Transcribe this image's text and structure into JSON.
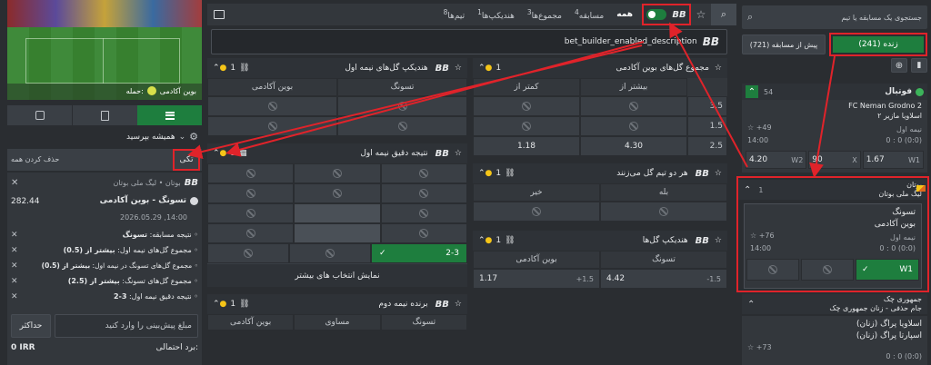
{
  "left": {
    "media": {
      "home_label": "حمله:",
      "team": "بوین آکادمی"
    },
    "tabs": [
      "betslip",
      "my-bets",
      "history"
    ],
    "settings_label": "همیشه بپرسید",
    "clear_label": "حذف کردن همه",
    "single_label": "تکی",
    "slip": {
      "league": "بوتان • لیگ ملی بوتان",
      "match": "تسونگ - بوین آکادمی",
      "odds": "282.44",
      "date": "2026.05.29 ,14:00"
    },
    "selections": [
      {
        "label": "نتیجه مسابقه:",
        "value": "تسونگ"
      },
      {
        "label": "مجموع گل‌های نیمه اول:",
        "value": "بیشتر از (0.5)"
      },
      {
        "label": "مجموع گل‌های تسونگ در نیمه اول:",
        "value": "بیشتر از (0.5)"
      },
      {
        "label": "مجموع گل‌های تسونگ:",
        "value": "بیشتر از (2.5)"
      },
      {
        "label": "نتیجه دقیق نیمه اول:",
        "value": "3-2"
      }
    ],
    "stake_placeholder": "مبلغ پیش‌بینی را وارد کنید",
    "max_label": "حداکثر",
    "potential_label": "برد احتمالی:",
    "potential_value": "0 IRR"
  },
  "center": {
    "tabs": [
      {
        "label": "همه",
        "sup": ""
      },
      {
        "label": "مسابقه",
        "sup": "4"
      },
      {
        "label": "مجموع‌ها",
        "sup": "3"
      },
      {
        "label": "هندیکپ‌ها",
        "sup": "1"
      },
      {
        "label": "تیم‌ها",
        "sup": "8"
      }
    ],
    "bb_logo": "BB",
    "banner_text": "bet_builder_enabled_description",
    "markets": {
      "first_half_handicap": {
        "title": "هندیکپ گل‌های نیمه اول",
        "count": "1",
        "cols": [
          "بوین آکادمی",
          "تسونگ"
        ]
      },
      "first_half_exact": {
        "title": "نتیجه دقیق نیمه اول",
        "count": "1",
        "selected": "2-3",
        "more": "نمایش انتخاب های بیشتر"
      },
      "second_half_winner": {
        "title": "برنده نیمه دوم",
        "count": "1",
        "cols": [
          "بوین آکادمی",
          "مساوی",
          "تسونگ"
        ]
      },
      "buin_totals": {
        "title": "مجموع گل‌های بوین آکادمی",
        "count": "1",
        "cols": [
          "کمتر از",
          "بیشتر از"
        ],
        "rows": [
          "3.5",
          "1.5",
          "2.5"
        ],
        "odd_under": "1.18",
        "odd_over": "4.30"
      },
      "btts": {
        "title": "هر دو تیم گل می‌زنند",
        "count": "1",
        "cols": [
          "خیر",
          "بله"
        ]
      },
      "handicap": {
        "title": "هندیکپ گل‌ها",
        "count": "1",
        "cols": [
          "بوین آکادمی",
          "تسونگ"
        ],
        "left_odd": "1.17",
        "left_line": "+1.5",
        "right_odd": "4.42",
        "right_line": "-1.5"
      }
    }
  },
  "right": {
    "search_placeholder": "جستجوی یک مسابقه یا تیم",
    "live_label": "زنده (241)",
    "prematch_label": "پیش از مسابقه (721)",
    "sport": {
      "name": "فوتبال",
      "count": "54"
    },
    "prev_match": {
      "team1": "FC Neman Grodno 2",
      "team2": "اسلاویا مازیر ۲",
      "half": "نیمه اول",
      "time": "14:00",
      "score": "0 : 0 (0:0)",
      "more": "+49",
      "odds": [
        "W1",
        "1.67",
        "X",
        "90",
        "W2",
        "4.20"
      ]
    },
    "country": {
      "name": "بوتان",
      "league": "لیگ ملی بوتان",
      "count": "1"
    },
    "match": {
      "team1": "تسونگ",
      "team2": "بوین آکادمی",
      "half": "نیمه اول",
      "time": "14:00",
      "score": "0 : 0 (0:0)",
      "more": "+76",
      "w1": "W1"
    },
    "country2": {
      "name": "جمهوری چک",
      "league": "جام حذفی - زنان جمهوری چک"
    },
    "match2": {
      "team1": "اسلاویا پراگ (زنان)",
      "team2": "اسپارتا پراگ (زنان)",
      "more": "+73",
      "score": "0 : 0 (0:0)"
    }
  }
}
